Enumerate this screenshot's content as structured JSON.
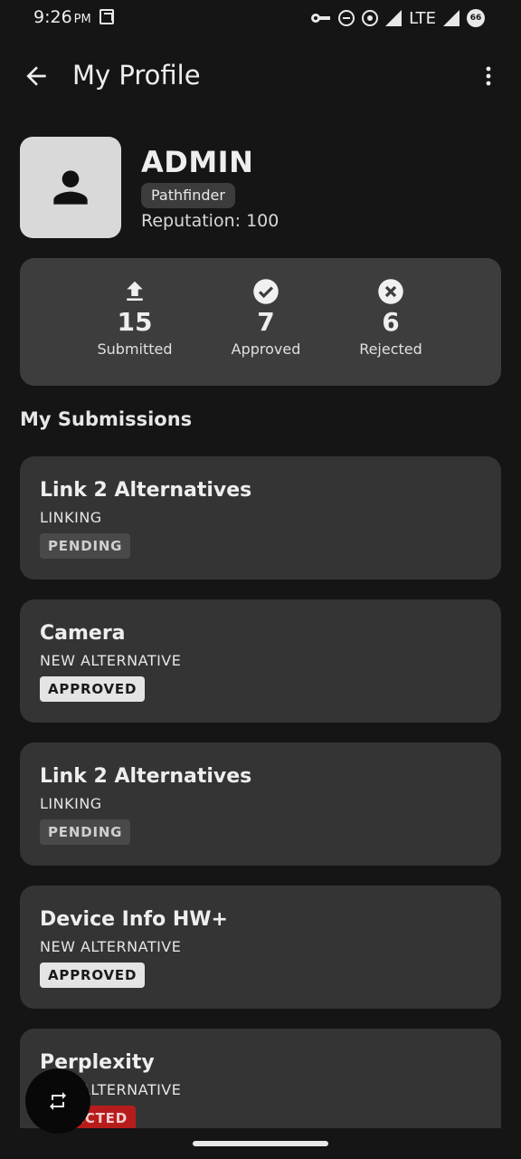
{
  "status_bar": {
    "time": "9:26",
    "ampm": "PM",
    "network": "LTE",
    "battery": "66"
  },
  "app_bar": {
    "title": "My Profile"
  },
  "profile": {
    "username": "ADMIN",
    "role": "Pathfinder",
    "reputation": "Reputation: 100"
  },
  "stats": [
    {
      "icon": "upload-icon",
      "value": "15",
      "label": "Submitted"
    },
    {
      "icon": "check-circle-icon",
      "value": "7",
      "label": "Approved"
    },
    {
      "icon": "cancel-circle-icon",
      "value": "6",
      "label": "Rejected"
    }
  ],
  "submissions_heading": "My Submissions",
  "submissions": [
    {
      "title": "Link 2 Alternatives",
      "type": "LINKING",
      "status": "PENDING"
    },
    {
      "title": "Camera",
      "type": "NEW ALTERNATIVE",
      "status": "APPROVED"
    },
    {
      "title": "Link 2 Alternatives",
      "type": "LINKING",
      "status": "PENDING"
    },
    {
      "title": "Device Info HW+",
      "type": "NEW ALTERNATIVE",
      "status": "APPROVED"
    },
    {
      "title": "Perplexity",
      "type": "NEW ALTERNATIVE",
      "status": "REJECTED"
    }
  ],
  "fab": {
    "icon": "swap-icon"
  },
  "colors": {
    "background": "#151515",
    "card": "#343434",
    "stats_card": "#3d3d3d",
    "pending_chip": "#494949",
    "approved_chip": "#e4e4e4",
    "rejected_chip": "#b71c1c"
  }
}
